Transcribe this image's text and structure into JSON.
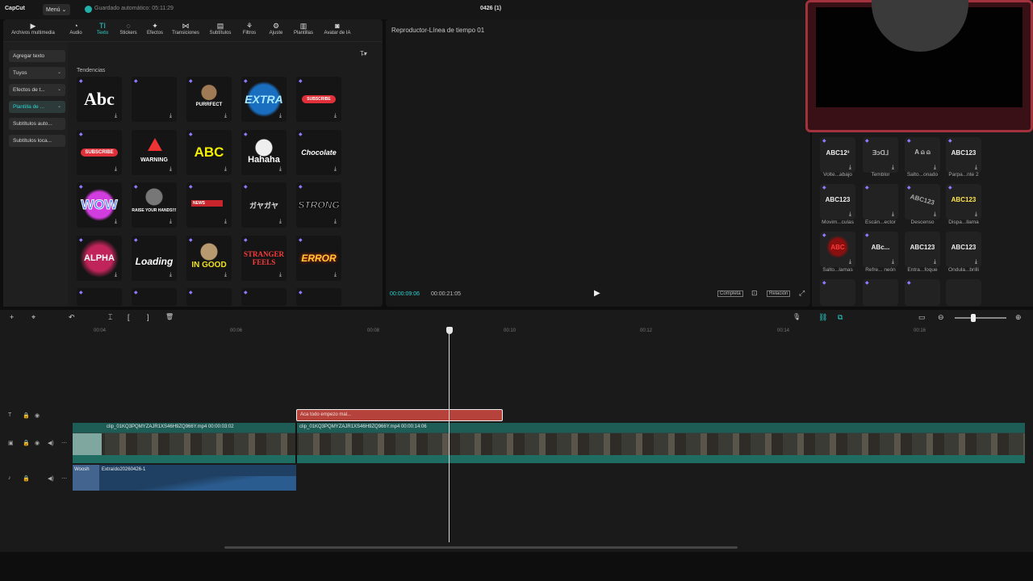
{
  "app": {
    "logo": "CapCut",
    "menu_label": "Menú",
    "menu_chevron": "⌄",
    "autosave": "Guardado automático: 05:11:29",
    "project_title": "0426 (1)"
  },
  "toolbar": {
    "items": [
      {
        "label": "Archivos multimedia",
        "icon": "▶"
      },
      {
        "label": "Audio",
        "icon": "◔"
      },
      {
        "label": "Texto",
        "icon": "TI"
      },
      {
        "label": "Stickers",
        "icon": "◌"
      },
      {
        "label": "Efectos",
        "icon": "✦"
      },
      {
        "label": "Transiciones",
        "icon": "⋈"
      },
      {
        "label": "Subtítulos",
        "icon": "▤"
      },
      {
        "label": "Filtros",
        "icon": "⚘"
      },
      {
        "label": "Ajuste",
        "icon": "⚙"
      },
      {
        "label": "Plantillas",
        "icon": "▥"
      },
      {
        "label": "Avatar de IA",
        "icon": "◙"
      }
    ]
  },
  "categories": [
    {
      "label": "Agregar texto"
    },
    {
      "label": "Tuyos"
    },
    {
      "label": "Efectos de t..."
    },
    {
      "label": "Plantilla de ..."
    },
    {
      "label": "Subtítulos auto..."
    },
    {
      "label": "Subtítulos loca..."
    }
  ],
  "trends": {
    "label": "Tendencias",
    "filter_icon": "T̶▾",
    "tiles": [
      {
        "text": "Abc"
      },
      {
        "text": ""
      },
      {
        "text": "PURRFECT"
      },
      {
        "text": "EXTRA"
      },
      {
        "text": "SUBSCRIBE"
      },
      {
        "text": "SUBSCRIBE"
      },
      {
        "text": "WARNING"
      },
      {
        "text": "ABC"
      },
      {
        "text": "Hahaha"
      },
      {
        "text": "Chocolate"
      },
      {
        "text": "WOW"
      },
      {
        "text": "RAISE YOUR HANDS!!!"
      },
      {
        "text": "NEWS"
      },
      {
        "text": "ガヤガヤ"
      },
      {
        "text": "STRONG"
      },
      {
        "text": "ALPHA"
      },
      {
        "text": "Loading"
      },
      {
        "text": "IN GOOD"
      },
      {
        "text": "STRANGER FEELS"
      },
      {
        "text": "ERROR"
      }
    ]
  },
  "player": {
    "title": "Reproductor-Línea de tiempo 01",
    "time_current": "00:00:09:06",
    "time_total": "00:00:21:05",
    "play_icon": "▶",
    "completa": "Completa",
    "relacion": "Relación",
    "screenshot_icon": "⊡",
    "fullscreen_icon": "⤢"
  },
  "effects": {
    "items": [
      {
        "text": "ABC12³",
        "label": "Volte...abajo"
      },
      {
        "text": "ƎɔⱭ⅃",
        "label": "Temblor"
      },
      {
        "text": "A ⍝ ⍝",
        "label": "Salto...onado"
      },
      {
        "text": "ABC123",
        "label": "Parpa...nte 2"
      },
      {
        "text": "ABC123",
        "label": "Movim...culas"
      },
      {
        "text": "",
        "label": "Escán...ector"
      },
      {
        "text": "ABC123",
        "label": "Descenso"
      },
      {
        "text": "ABC123",
        "label": "Dispa...llama"
      },
      {
        "text": "ABC",
        "label": "Salto...lamas"
      },
      {
        "text": "ABc...",
        "label": "Refre... neón"
      },
      {
        "text": "ABC123",
        "label": "Entra...foque"
      },
      {
        "text": "ABC123",
        "label": "Ondula...brilli"
      }
    ]
  },
  "timeline": {
    "ticks": [
      "00:04",
      "00:06",
      "00:08",
      "00:10",
      "00:12",
      "00:14",
      "00:16"
    ],
    "text_clip": "Aca todo empezo mal...",
    "video1": "clip_01KQ3PQMYZAJR1XS46H9ZQ966Y.mp4  00:00:03:02",
    "video2": "clip_01KQ3PQMYZAJR1XS46H9ZQ966Y.mp4  00:00:14:06",
    "audio1": "Woosh",
    "audio2": "Extraído20260426-1",
    "icons": {
      "add": "+",
      "select": "⌖",
      "undo": "↶",
      "split": "⌶",
      "split_left": "[",
      "split_right": "]",
      "delete": "🗑",
      "mic": "🎙",
      "link": "⛓",
      "zoom_out": "⊖",
      "zoom_in": "⊕",
      "preview": "▭",
      "snap": "⧉"
    }
  },
  "colors": {
    "accent": "#2ad5d0",
    "text_clip": "#b6423c",
    "video_track": "#1e5d56",
    "audio_track": "#1f4063"
  }
}
